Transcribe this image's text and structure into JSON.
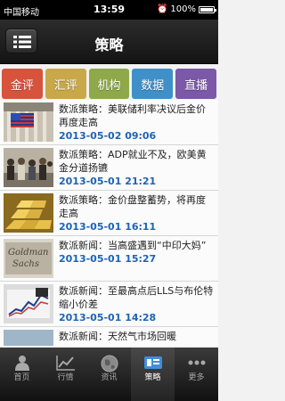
{
  "status_bar": {
    "carrier": "中国移动",
    "time": "13:59",
    "battery": "100%"
  },
  "nav": {
    "title": "策略"
  },
  "tabs": [
    {
      "label": "金评",
      "color": "#d8533c"
    },
    {
      "label": "汇评",
      "color": "#c9a84a"
    },
    {
      "label": "机构",
      "color": "#8ea84a"
    },
    {
      "label": "数据",
      "color": "#3f8fc9"
    },
    {
      "label": "直播",
      "color": "#7b58a8"
    }
  ],
  "news": [
    {
      "headline": "数派策略：美联储利率决议后金价再度走高",
      "date": "2013-05-02 09:06"
    },
    {
      "headline": "数派策略：ADP就业不及，欧美黄金分道扬镳",
      "date": "2013-05-01 21:21"
    },
    {
      "headline": "数派策略：金价盘整蓄势，将再度走高",
      "date": "2013-05-01 16:11"
    },
    {
      "headline": "数派新闻：当高盛遇到“中印大妈”",
      "date": "2013-05-01 15:27"
    },
    {
      "headline": "数派新闻：至最高点后LLS与布伦特缩小价差",
      "date": "2013-05-01 14:28"
    },
    {
      "headline": "数派新闻：天然气市场回暖",
      "date": ""
    }
  ],
  "tab_bar": [
    {
      "label": "首页",
      "icon": "person-icon"
    },
    {
      "label": "行情",
      "icon": "chart-icon"
    },
    {
      "label": "资讯",
      "icon": "globe-icon"
    },
    {
      "label": "策略",
      "icon": "strategy-icon"
    },
    {
      "label": "更多",
      "icon": "more-icon"
    }
  ]
}
